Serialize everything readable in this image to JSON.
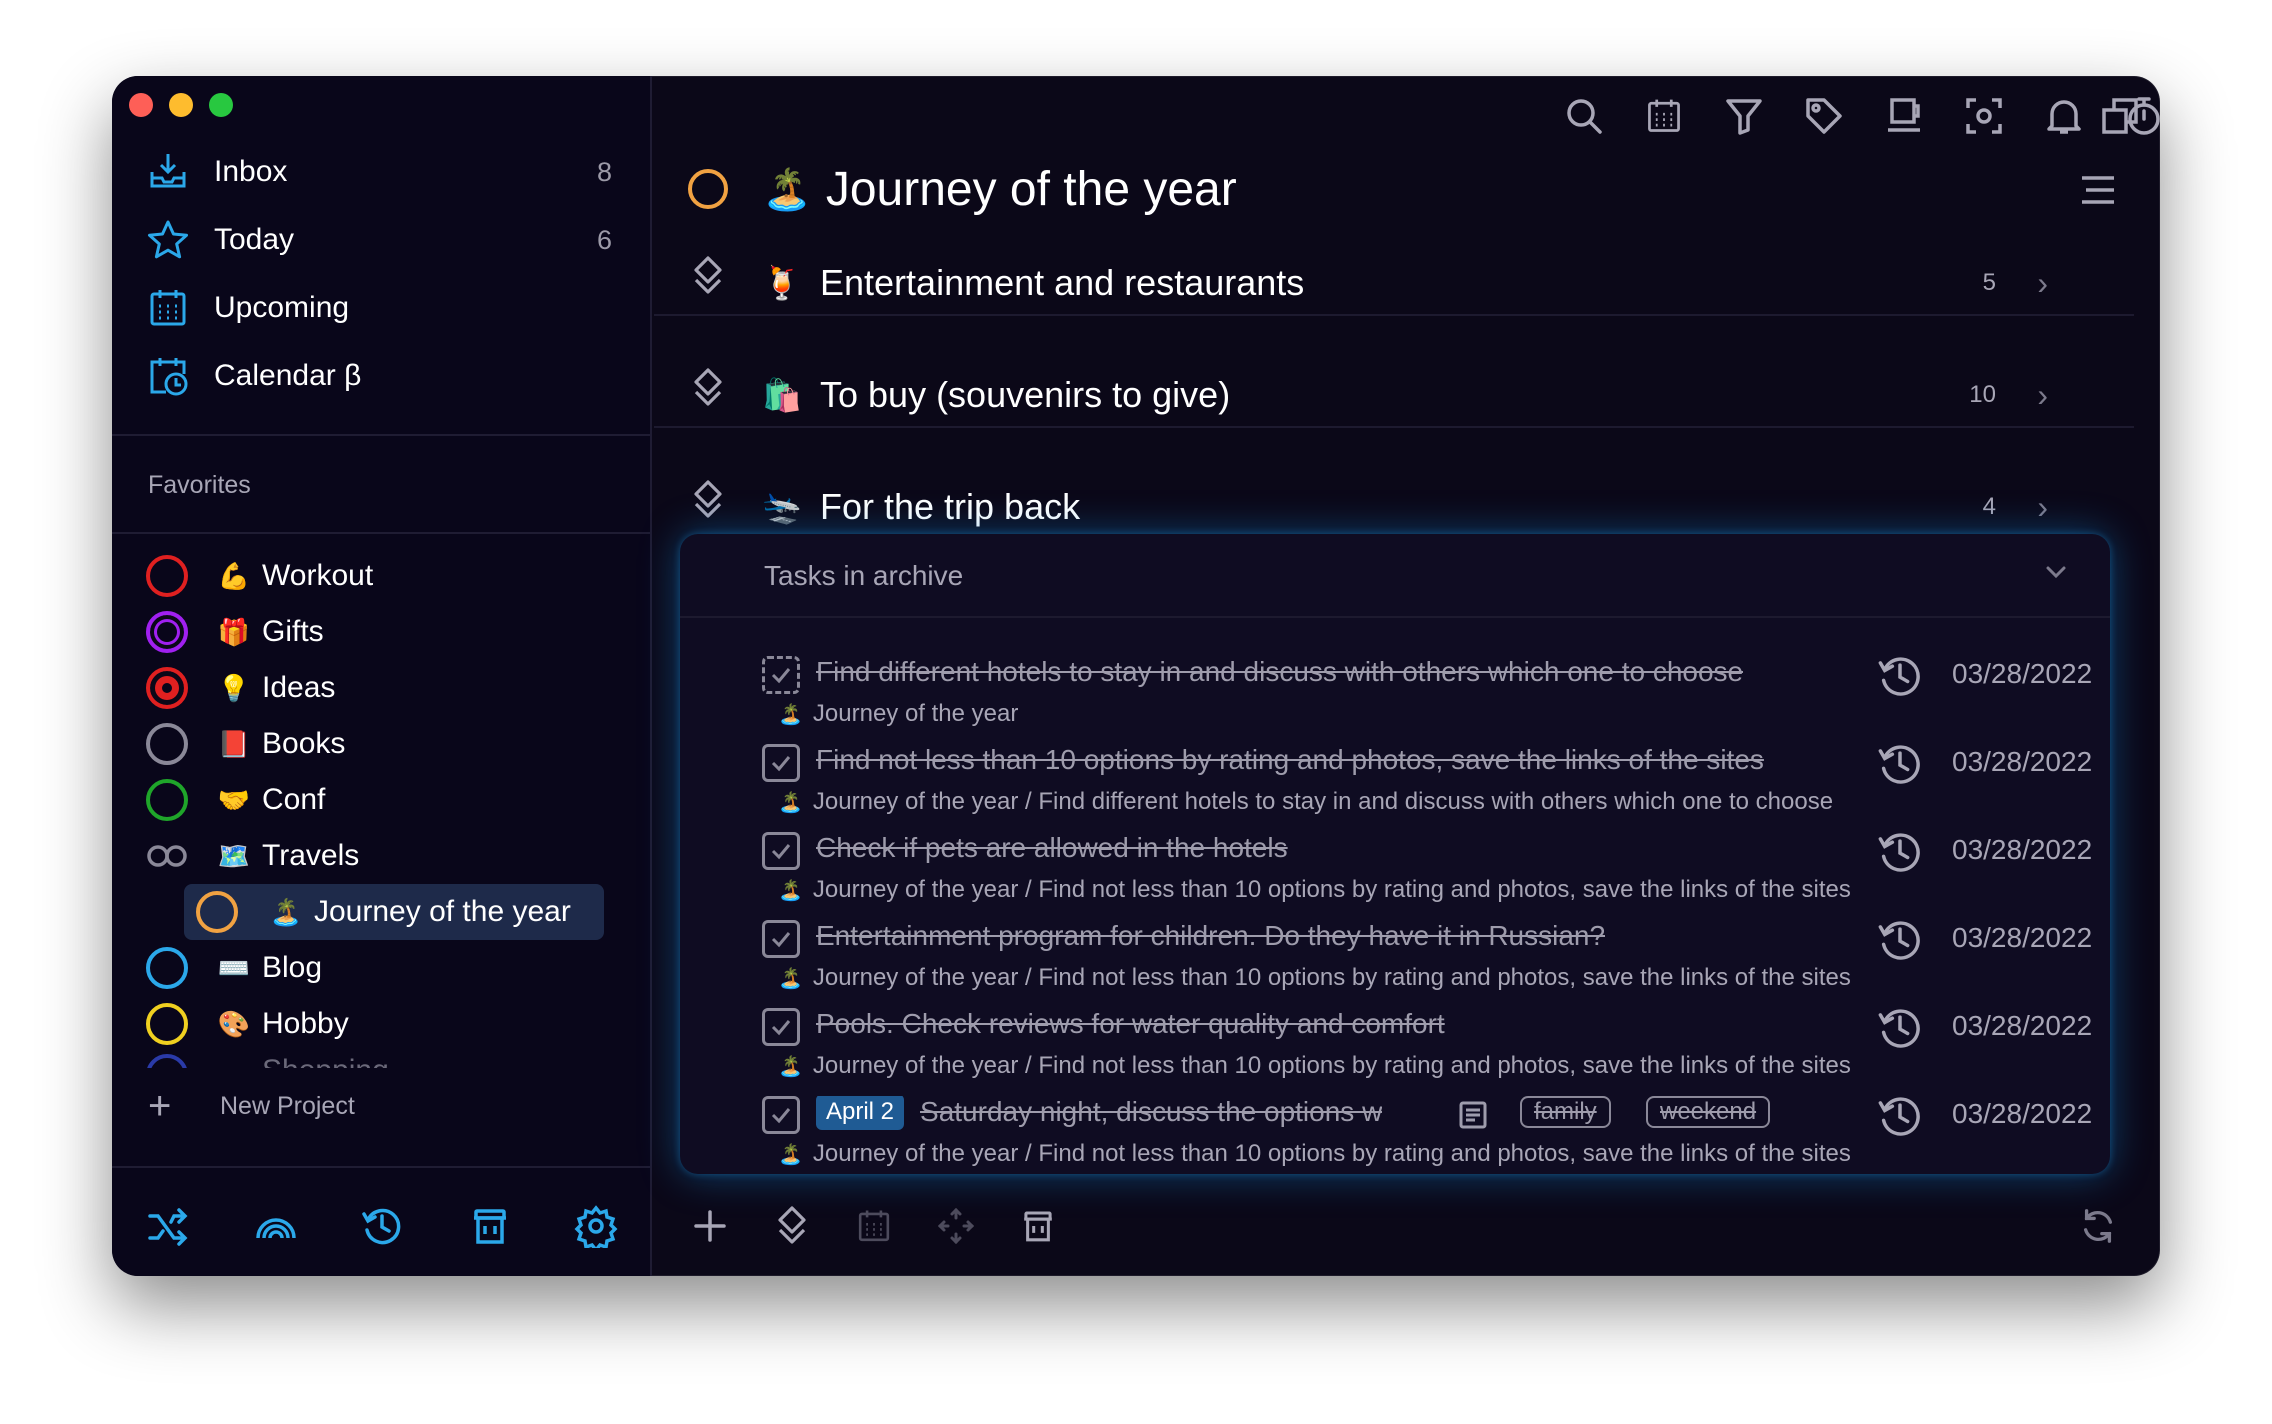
{
  "sidebar": {
    "nav": [
      {
        "label": "Inbox",
        "count": "8"
      },
      {
        "label": "Today",
        "count": "6"
      },
      {
        "label": "Upcoming",
        "count": ""
      },
      {
        "label": "Calendar β",
        "count": ""
      }
    ],
    "favorites_title": "Favorites",
    "projects": [
      {
        "label": "Workout",
        "emoji": "💪",
        "color": "#e02020"
      },
      {
        "label": "Gifts",
        "emoji": "🎁",
        "color": "#a020f0"
      },
      {
        "label": "Ideas",
        "emoji": "💡",
        "color": "#e02020"
      },
      {
        "label": "Books",
        "emoji": "📕",
        "color": "#8a8898"
      },
      {
        "label": "Conf",
        "emoji": "🤝",
        "color": "#1fa52a"
      },
      {
        "label": "Travels",
        "emoji": "🗺️",
        "color": "#8a8898"
      },
      {
        "label": "Journey of the year",
        "emoji": "🏝️",
        "color": "#f1a242"
      },
      {
        "label": "Blog",
        "emoji": "⌨️",
        "color": "#2ba8ea"
      },
      {
        "label": "Hobby",
        "emoji": "🎨",
        "color": "#f0d020"
      },
      {
        "label": "Shopping",
        "emoji": "",
        "color": "#2a3aa8"
      }
    ],
    "new_project": "New Project"
  },
  "main": {
    "title": "Journey of the year",
    "title_emoji": "🏝️",
    "sections": [
      {
        "label": "Entertainment and restaurants",
        "emoji": "🍹",
        "count": "5"
      },
      {
        "label": "To buy (souvenirs to give)",
        "emoji": "🛍️",
        "count": "10"
      },
      {
        "label": "For the trip back",
        "emoji": "🛬",
        "count": "4"
      }
    ],
    "archive": {
      "title": "Tasks in archive",
      "tasks": [
        {
          "title": "Find different hotels to stay in and discuss with others which one to choose",
          "path": "Journey of the year",
          "date": "03/28/2022"
        },
        {
          "title": "Find not less than 10 options by rating and photos, save the links of the sites",
          "path": "Journey of the year / Find different hotels to stay in and discuss with others which one to choose",
          "date": "03/28/2022"
        },
        {
          "title": "Check if pets are allowed in the hotels",
          "path": "Journey of the year / Find not less than 10 options by rating and photos, save the links of the sites",
          "date": "03/28/2022"
        },
        {
          "title": "Entertainment program for children. Do they have it in Russian?",
          "path": "Journey of the year / Find not less than 10 options by rating and photos, save the links of the sites",
          "date": "03/28/2022"
        },
        {
          "title": "Pools. Check reviews for water quality and comfort",
          "path": "Journey of the year / Find not less than 10 options by rating and photos, save the links of the sites",
          "date": "03/28/2022"
        },
        {
          "title": "Saturday night, discuss the options w",
          "badge": "April 2",
          "tags": [
            "family",
            "weekend"
          ],
          "path": "Journey of the year / Find not less than 10 options by rating and photos, save the links of the sites",
          "date": "03/28/2022"
        }
      ]
    }
  },
  "colors": {
    "accent": "#2ba8ea",
    "background": "#0b0818",
    "title_ring": "#f1a242"
  }
}
